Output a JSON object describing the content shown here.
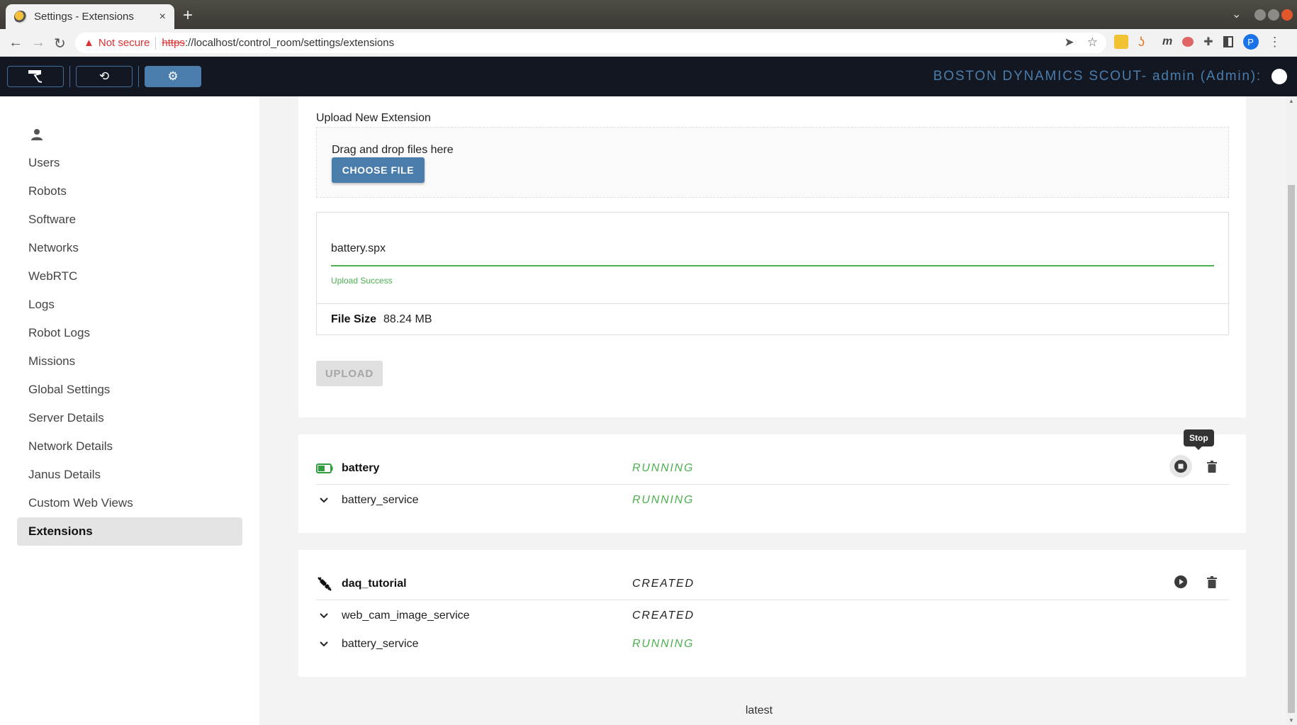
{
  "browser": {
    "tab_title": "Settings - Extensions",
    "new_tab": "+",
    "close_tab": "×",
    "security_label": "Not secure",
    "url_scheme": "https",
    "url_rest": "://localhost/control_room/settings/extensions",
    "profile_initial": "P"
  },
  "header": {
    "brand": "BOSTON DYNAMICS SCOUT- admin (Admin):",
    "nav_buttons": [
      {
        "name": "robot-control",
        "icon": "robot-icon"
      },
      {
        "name": "history",
        "icon": "history-icon"
      },
      {
        "name": "settings",
        "icon": "gear-icon",
        "active": true
      }
    ]
  },
  "sidebar": {
    "items": [
      {
        "label": "Users"
      },
      {
        "label": "Robots"
      },
      {
        "label": "Software"
      },
      {
        "label": "Networks"
      },
      {
        "label": "WebRTC"
      },
      {
        "label": "Logs"
      },
      {
        "label": "Robot Logs"
      },
      {
        "label": "Missions"
      },
      {
        "label": "Global Settings"
      },
      {
        "label": "Server Details"
      },
      {
        "label": "Network Details"
      },
      {
        "label": "Janus Details"
      },
      {
        "label": "Custom Web Views"
      },
      {
        "label": "Extensions",
        "active": true
      }
    ]
  },
  "upload": {
    "title": "Upload New Extension",
    "drop_text": "Drag and drop files here",
    "choose_label": "CHOOSE FILE",
    "file_name": "battery.spx",
    "progress": 1.0,
    "status": "Upload Success",
    "file_size_label": "File Size",
    "file_size_value": "88.24 MB",
    "upload_label": "UPLOAD"
  },
  "extensions": [
    {
      "name": "battery",
      "icon": "battery-icon",
      "status": "RUNNING",
      "action": "stop",
      "tooltip": "Stop",
      "services": [
        {
          "name": "battery_service",
          "status": "RUNNING"
        }
      ]
    },
    {
      "name": "daq_tutorial",
      "icon": "plug-off-icon",
      "status": "CREATED",
      "action": "play",
      "services": [
        {
          "name": "web_cam_image_service",
          "status": "CREATED"
        },
        {
          "name": "battery_service",
          "status": "RUNNING"
        }
      ]
    }
  ],
  "footer": {
    "version": "latest"
  },
  "colors": {
    "accent": "#4a7dab",
    "header_bg": "#131722",
    "running": "#4caf50",
    "created": "#222222"
  }
}
